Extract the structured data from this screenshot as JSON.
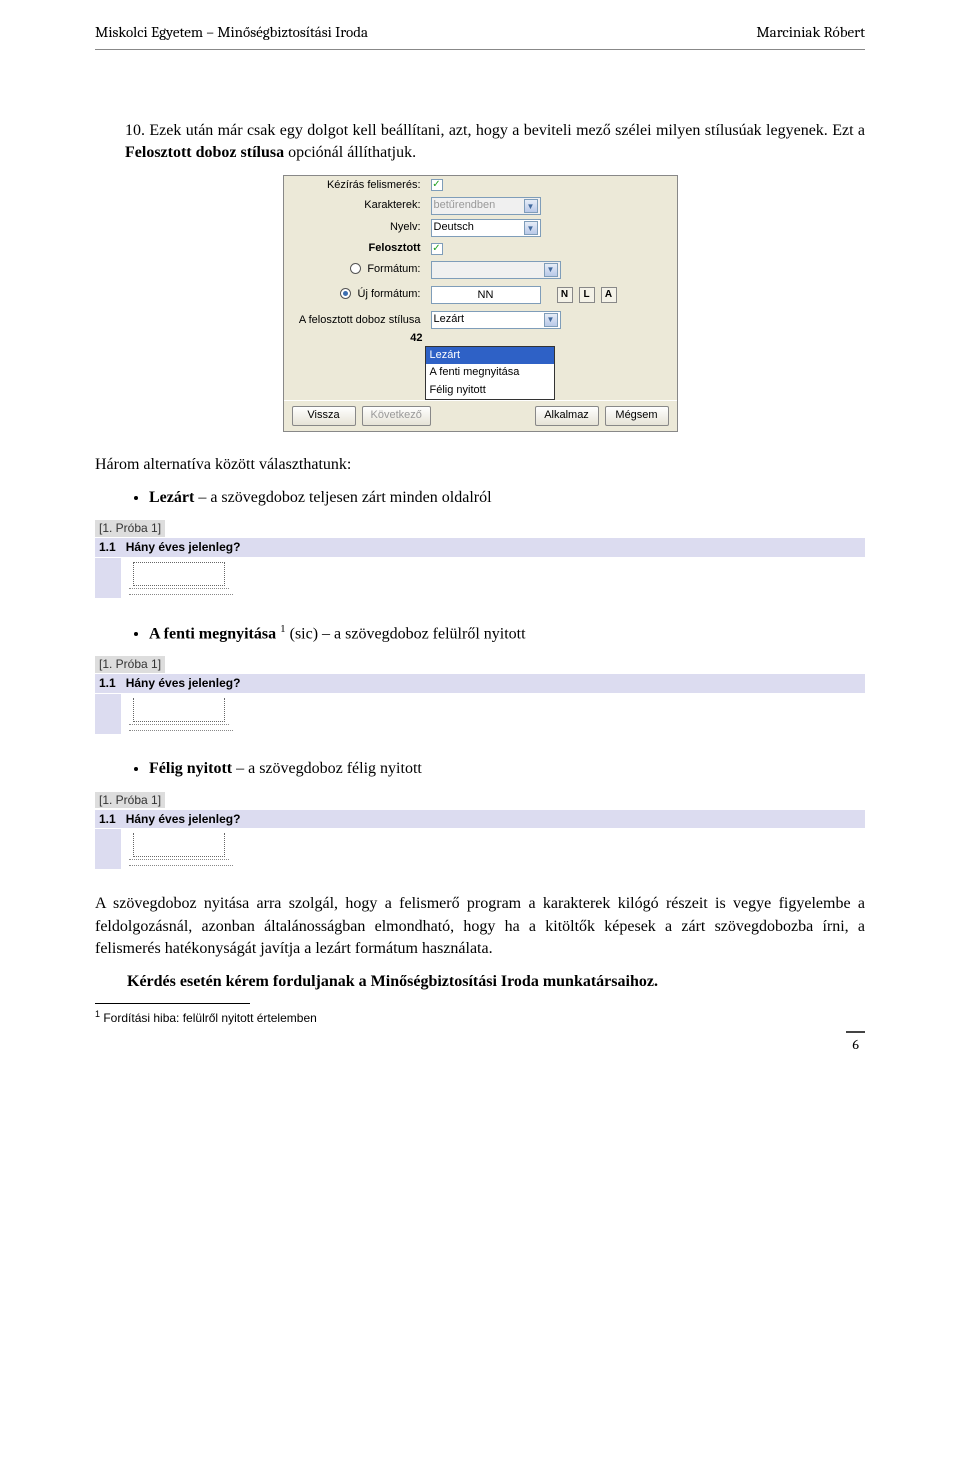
{
  "header": {
    "left": "Miskolci Egyetem – Minőségbiztosítási Iroda",
    "right": "Marciniak Róbert"
  },
  "para10": "Ezek után már csak egy dolgot kell beállítani, azt, hogy a beviteli mező szélei milyen stílusúak legyenek. Ezt a ",
  "para10_bold": "Felosztott doboz stílusa",
  "para10_tail": " opciónál állíthatjuk.",
  "dialog": {
    "kez": "Kézírás felismerés:",
    "karakterek_l": "Karakterek:",
    "karakterek_v": "betűrendben",
    "nyelv_l": "Nyelv:",
    "nyelv_v": "Deutsch",
    "felosztott": "Felosztott",
    "formatum_l": "Formátum:",
    "ujformatum_l": "Új formátum:",
    "nn": "NN",
    "sq": [
      "N",
      "L",
      "A"
    ],
    "felstyle_l": "A felosztott doboz stílusa",
    "felstyle_v": "Lezárt",
    "fortytwo": "42",
    "dd_items": [
      "Lezárt",
      "A fenti megnyitása",
      "Félig nyitott"
    ],
    "btn_vissza": "Vissza",
    "btn_kov": "Következő",
    "btn_alk": "Alkalmaz",
    "btn_meg": "Mégsem"
  },
  "threealt": "Három alternatíva között választhatunk:",
  "bullet1": {
    "b": "Lezárt",
    "t": " – a szövegdoboz teljesen zárt minden oldalról"
  },
  "bullet2": {
    "b": "A fenti megnyitása",
    "sup": "1",
    "t": " (sic) – a szövegdoboz felülről nyitott"
  },
  "bullet3": {
    "b": "Félig nyitott",
    "t": " – a szövegdoboz félig nyitott"
  },
  "sample": {
    "caption": "[1. Próba 1]",
    "qnum": "1.1",
    "qtext": "Hány éves jelenleg?"
  },
  "closing_para": "A szövegdoboz nyitása arra szolgál, hogy a felismerő program a karakterek kilógó részeit is vegye figyelembe a feldolgozásnál, azonban általánosságban elmondható, hogy ha a kitöltők képesek a zárt szövegdobozba írni, a felismerés hatékonyságát javítja a lezárt formátum használata.",
  "closing_bold": "Kérdés esetén kérem forduljanak a Minőségbiztosítási Iroda munkatársaihoz.",
  "footnote": {
    "num": "1",
    "text": " Fordítási hiba: felülről nyitott értelemben"
  },
  "pagenum": "6"
}
